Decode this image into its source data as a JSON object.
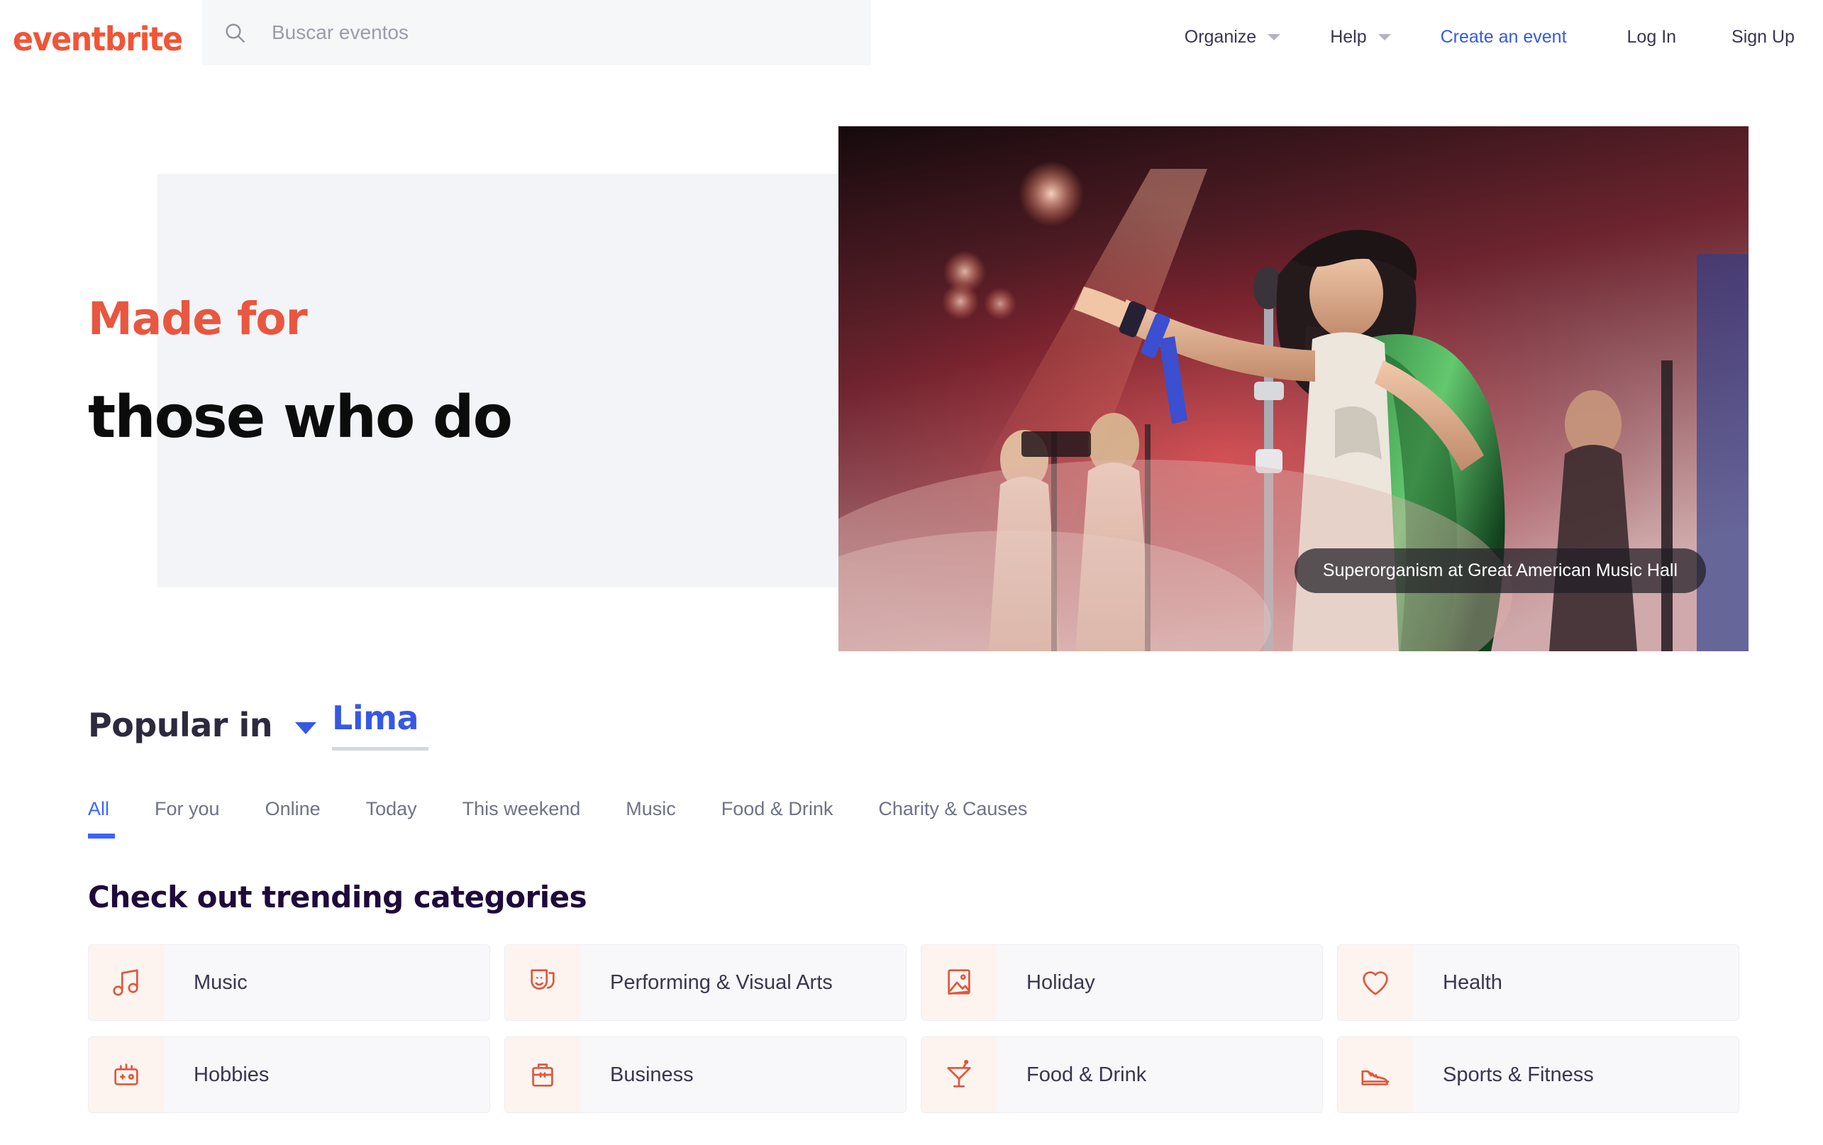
{
  "header": {
    "logo_text": "eventbrite",
    "logo_color": "#f05537",
    "search": {
      "placeholder": "Buscar eventos",
      "value": "",
      "icon": "search-icon"
    },
    "nav": [
      {
        "label": "Organize",
        "has_chevron": true,
        "accent": false
      },
      {
        "label": "Help",
        "has_chevron": true,
        "accent": false
      },
      {
        "label": "Create an event",
        "has_chevron": false,
        "accent": true,
        "color": "#3659e3"
      },
      {
        "label": "Log In",
        "has_chevron": false,
        "accent": false
      },
      {
        "label": "Sign Up",
        "has_chevron": false,
        "accent": false
      }
    ]
  },
  "hero": {
    "line1": "Made for",
    "line1_color": "#e8573f",
    "line2": "those who do",
    "line2_color": "#0d0c0c",
    "panel_color": "#f2f4f8",
    "image_caption": "Superorganism at Great American Music Hall"
  },
  "popular": {
    "label": "Popular in",
    "city": "Lima",
    "city_color": "#3659e3",
    "chevron_icon": "chevron-down-icon"
  },
  "tabs": [
    {
      "label": "All",
      "active": true
    },
    {
      "label": "For you",
      "active": false
    },
    {
      "label": "Online",
      "active": false
    },
    {
      "label": "Today",
      "active": false
    },
    {
      "label": "This weekend",
      "active": false
    },
    {
      "label": "Music",
      "active": false
    },
    {
      "label": "Food & Drink",
      "active": false
    },
    {
      "label": "Charity & Causes",
      "active": false
    }
  ],
  "categories": {
    "heading": "Check out trending categories",
    "accent_color": "#e8573f",
    "items": [
      {
        "label": "Music",
        "icon": "music-note-icon"
      },
      {
        "label": "Performing & Visual Arts",
        "icon": "theater-masks-icon"
      },
      {
        "label": "Holiday",
        "icon": "picture-frame-icon"
      },
      {
        "label": "Health",
        "icon": "heart-icon"
      },
      {
        "label": "Hobbies",
        "icon": "game-controller-icon"
      },
      {
        "label": "Business",
        "icon": "briefcase-icon"
      },
      {
        "label": "Food & Drink",
        "icon": "cocktail-glass-icon"
      },
      {
        "label": "Sports & Fitness",
        "icon": "sneaker-icon"
      }
    ]
  }
}
